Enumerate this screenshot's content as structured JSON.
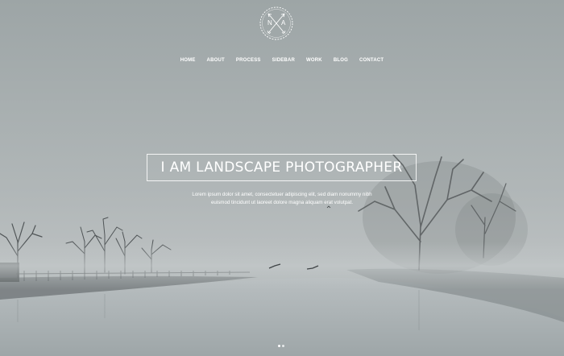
{
  "logo": {
    "left_letter": "N",
    "right_letter": "A",
    "icon": "crossed-arrows-wreath-icon"
  },
  "nav": {
    "items": [
      {
        "label": "HOME"
      },
      {
        "label": "ABOUT"
      },
      {
        "label": "PROCESS"
      },
      {
        "label": "SIDEBAR"
      },
      {
        "label": "WORK"
      },
      {
        "label": "BLOG"
      },
      {
        "label": "CONTACT"
      }
    ]
  },
  "hero": {
    "headline": "I AM LANDSCAPE PHOTOGRAPHER",
    "lead_line1": "Lorem ipsum dolor sit amet, consectetuer adipiscing elit, sed diam nonummy nibh",
    "lead_line2": "euismod tincidunt ut laoreet dolore magna aliquam erat volutpat.",
    "slides_total": 2,
    "slide_active": 1
  },
  "colors": {
    "text": "#ffffff",
    "fog": "#b1b7b8",
    "trees": "#4f5456"
  }
}
